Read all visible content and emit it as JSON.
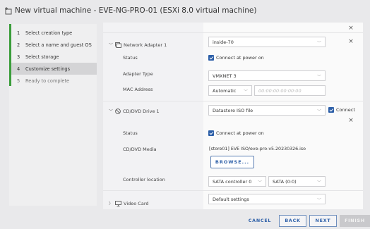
{
  "title": "New virtual machine - EVE-NG-PRO-01 (ESXi 8.0 virtual machine)",
  "wizard": {
    "steps": [
      {
        "num": "1",
        "label": "Select creation type"
      },
      {
        "num": "2",
        "label": "Select a name and guest OS"
      },
      {
        "num": "3",
        "label": "Select storage"
      },
      {
        "num": "4",
        "label": "Customize settings"
      },
      {
        "num": "5",
        "label": "Ready to complete"
      }
    ],
    "active_step": 4
  },
  "network_adapter": {
    "label": "Network Adapter 1",
    "network": "inside-70",
    "status_label": "Status",
    "status_value": "Connect at power on",
    "adapter_type_label": "Adapter Type",
    "adapter_type": "VMXNET 3",
    "mac_label": "MAC Address",
    "mac_mode": "Automatic",
    "mac_placeholder": "00:00:00:00:00:00"
  },
  "cd_dvd": {
    "label": "CD/DVD Drive 1",
    "source": "Datastore ISO file",
    "connect_label": "Connect",
    "status_label": "Status",
    "status_value": "Connect at power on",
    "media_label": "CD/DVD Media",
    "media_value": "[store01] EVE ISO/eve-pro-v5.20230326.iso",
    "browse_label": "BROWSE...",
    "controller_label": "Controller location",
    "controller": "SATA controller 0",
    "port": "SATA (0:0)"
  },
  "video_card": {
    "label": "Video Card",
    "value": "Default settings"
  },
  "footer": {
    "cancel": "CANCEL",
    "back": "BACK",
    "next": "NEXT",
    "finish": "FINISH"
  },
  "colors": {
    "accent": "#2d5fa8",
    "progress": "#3a9d3a"
  }
}
